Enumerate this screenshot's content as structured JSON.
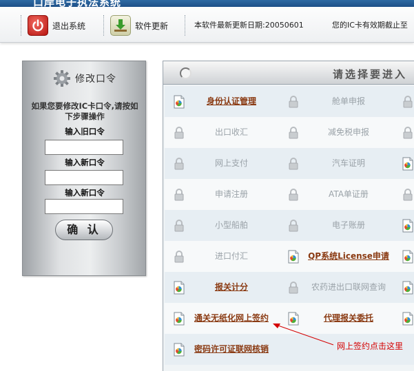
{
  "window": {
    "title": "口岸电子执法系统"
  },
  "toolbar": {
    "exit_label": "退出系统",
    "update_label": "软件更新",
    "last_update_text": "本软件最新更新日期:20050601",
    "ic_card_text": "您的IC卡有效期截止至"
  },
  "password_panel": {
    "title": "修改口令",
    "instructions": "如果您要修改IC卡口令,请按如下步骤操作",
    "old_label": "输入旧口令",
    "new_label": "输入新口令",
    "confirm_label": "输入新口令",
    "confirm_button": "确 认",
    "old_value": "",
    "new_value": "",
    "confirm_value": ""
  },
  "systems_panel": {
    "title": "请选择要进入",
    "rows": [
      {
        "left": {
          "label": "身份认证管理",
          "enabled": true
        },
        "right": {
          "label": "舱单申报",
          "enabled": false
        }
      },
      {
        "left": {
          "label": "出口收汇",
          "enabled": false
        },
        "right": {
          "label": "减免税申报",
          "enabled": false
        }
      },
      {
        "left": {
          "label": "网上支付",
          "enabled": false
        },
        "right": {
          "label": "汽车证明",
          "enabled": false
        }
      },
      {
        "left": {
          "label": "申请注册",
          "enabled": false
        },
        "right": {
          "label": "ATA单证册",
          "enabled": false
        }
      },
      {
        "left": {
          "label": "小型船舶",
          "enabled": false
        },
        "right": {
          "label": "电子账册",
          "enabled": false
        }
      },
      {
        "left": {
          "label": "进口付汇",
          "enabled": false
        },
        "right": {
          "label": "QP系统License申请",
          "enabled": true
        }
      },
      {
        "left": {
          "label": "报关计分",
          "enabled": true
        },
        "right": {
          "label": "农药进出口联网查询",
          "enabled": false
        }
      },
      {
        "left": {
          "label": "通关无纸化网上签约",
          "enabled": true
        },
        "right": {
          "label": "代理报关委托",
          "enabled": true
        }
      },
      {
        "left": {
          "label": "密码许可证联网核销",
          "enabled": true
        },
        "right": {
          "label": "",
          "enabled": false
        }
      }
    ]
  },
  "annotation": {
    "text": "网上签约点击这里",
    "color": "#d40000"
  },
  "colors": {
    "active_link": "#8a3a12",
    "disabled_text": "#9aa2a8",
    "title_bar": "#1e5088"
  }
}
